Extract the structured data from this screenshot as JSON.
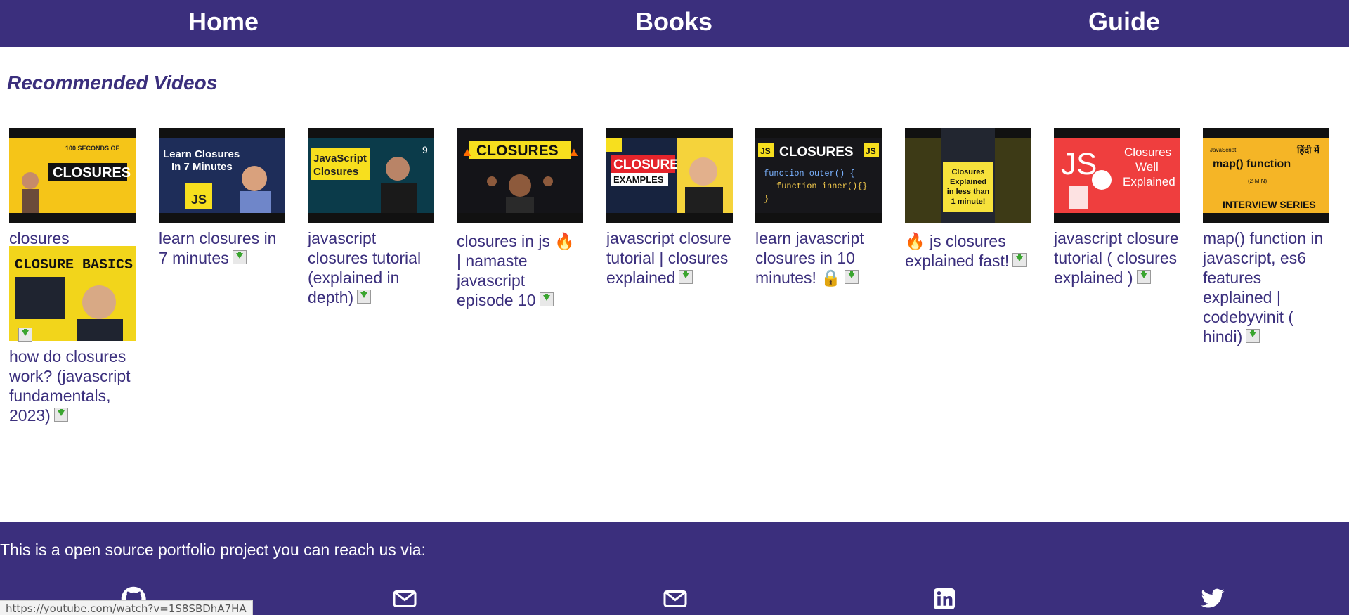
{
  "nav": {
    "home": "Home",
    "books": "Books",
    "guide": "Guide"
  },
  "heading": "Recommended Videos",
  "videos": [
    {
      "title": "closures",
      "thumb_text": "CLOSURES",
      "thumb_sub": "100 SECONDS OF"
    },
    {
      "title": "learn closures in 7 minutes",
      "thumb_text": "Learn Closures In 7 Minutes",
      "thumb_sub": "JS"
    },
    {
      "title": "javascript closures tutorial (explained in depth)",
      "thumb_text": "JavaScript Closures",
      "thumb_sub": "9"
    },
    {
      "title": "closures in js 🔥 | namaste javascript episode 10",
      "thumb_text": "CLOSURES",
      "thumb_sub": ""
    },
    {
      "title": "javascript closure tutorial | closures explained",
      "thumb_text": "CLOSURE",
      "thumb_sub": "EXAMPLES"
    },
    {
      "title": "learn javascript closures in 10 minutes! 🔒",
      "thumb_text": "CLOSURES",
      "thumb_sub": "function outer() {"
    },
    {
      "title": "🔥 js closures explained fast!",
      "thumb_text": "Closures Explained in less than 1 minute!",
      "thumb_sub": ""
    },
    {
      "title": "javascript closure tutorial ( closures explained )",
      "thumb_text": "Closures Well Explained",
      "thumb_sub": "JS"
    },
    {
      "title": "map() function in javascript, es6 features explained | codebyvinit ( hindi)",
      "thumb_text": "map() function",
      "thumb_sub": "INTERVIEW SERIES"
    },
    {
      "title": "how do closures work? (javascript fundamentals, 2023)",
      "thumb_text": "CLOSURE BASICS",
      "thumb_sub": ""
    }
  ],
  "footer": {
    "text": "This is a open source portfolio project you can reach us via:",
    "icons": [
      "github-icon",
      "mail-icon",
      "mail-icon",
      "linkedin-icon",
      "twitter-icon"
    ]
  },
  "status_url": "https://youtube.com/watch?v=1S8SBDhA7HA",
  "colors": {
    "brand": "#3b2f7d",
    "download": "#3aa52f"
  }
}
